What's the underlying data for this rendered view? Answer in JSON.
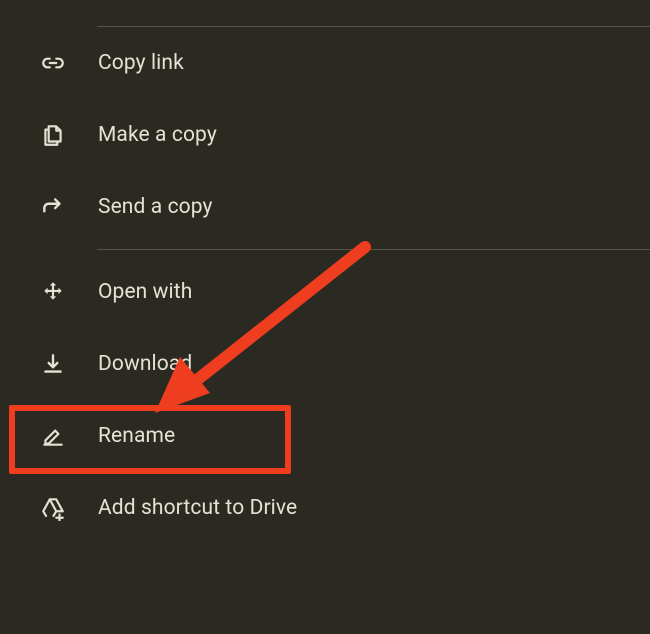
{
  "menu": {
    "items": [
      {
        "label": "Copy link",
        "icon": "link"
      },
      {
        "label": "Make a copy",
        "icon": "file-copy"
      },
      {
        "label": "Send a copy",
        "icon": "arrow-forward"
      },
      {
        "label": "Open with",
        "icon": "move-arrows"
      },
      {
        "label": "Download",
        "icon": "download"
      },
      {
        "label": "Rename",
        "icon": "pencil-line"
      },
      {
        "label": "Add shortcut to Drive",
        "icon": "drive-add"
      }
    ]
  },
  "annotation": {
    "highlight_color": "#ef3d1f"
  }
}
